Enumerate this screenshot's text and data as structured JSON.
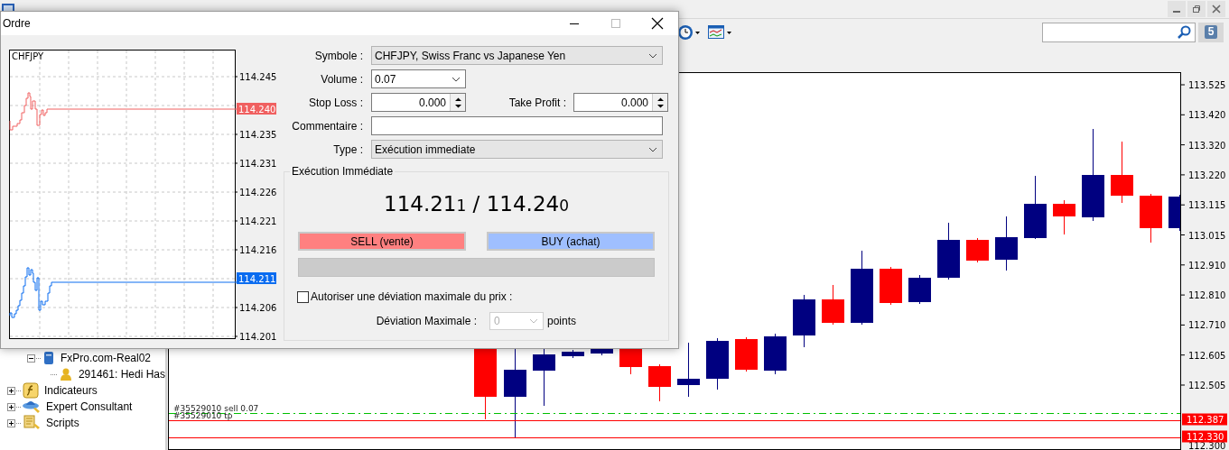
{
  "toolbar": {
    "notification_count": "5"
  },
  "navigator": {
    "items": [
      {
        "kind": "server",
        "label": "FxPro.com-Real02",
        "expanded": true,
        "children": [
          {
            "kind": "account",
            "label": "291461: Hedi Has"
          }
        ]
      },
      {
        "kind": "indicator",
        "label": "Indicateurs",
        "expanded": false
      },
      {
        "kind": "expert",
        "label": "Expert Consultant",
        "expanded": false
      },
      {
        "kind": "script",
        "label": "Scripts",
        "expanded": false
      }
    ]
  },
  "chart": {
    "price_labels": [
      "113.525",
      "113.420",
      "113.320",
      "113.220",
      "113.115",
      "113.015",
      "112.910",
      "112.810",
      "112.710",
      "112.605",
      "112.505"
    ],
    "bottom_label": "112.300",
    "price_markers": [
      "112.387",
      "112.330"
    ],
    "order_lines": [
      "#35529010 sell 0.07",
      "#35529010 tp"
    ]
  },
  "order_dialog": {
    "title": "Ordre",
    "tick_chart": {
      "symbol": "CHFJPY",
      "price_labels": [
        "114.245",
        "114.235",
        "114.231",
        "114.226",
        "114.221",
        "114.216",
        "114.206",
        "114.201"
      ],
      "ask_marker": "114.240",
      "bid_marker": "114.211"
    },
    "symbol": {
      "label": "Symbole :",
      "value": "CHFJPY, Swiss Franc vs Japanese Yen"
    },
    "volume": {
      "label": "Volume :",
      "value": "0.07"
    },
    "stop_loss": {
      "label": "Stop Loss :",
      "value": "0.000"
    },
    "take_profit": {
      "label": "Take Profit :",
      "value": "0.000"
    },
    "comment": {
      "label": "Commentaire :"
    },
    "type": {
      "label": "Type :",
      "value": "Exécution immediate"
    },
    "execution": {
      "title": "Exécution Immédiate",
      "quote": "114.21$_{1}$ / 114.24$_{0}$",
      "sell_button": "SELL (vente)",
      "buy_button": "BUY (achat)",
      "progress": {
        "level": 0
      },
      "allow_deviation": {
        "label": "Autoriser une déviation maximale du prix :",
        "checked": false
      },
      "deviation": {
        "label": "Déviation Maximale :",
        "value": "0",
        "disabled": true,
        "unit": "points"
      }
    }
  }
}
